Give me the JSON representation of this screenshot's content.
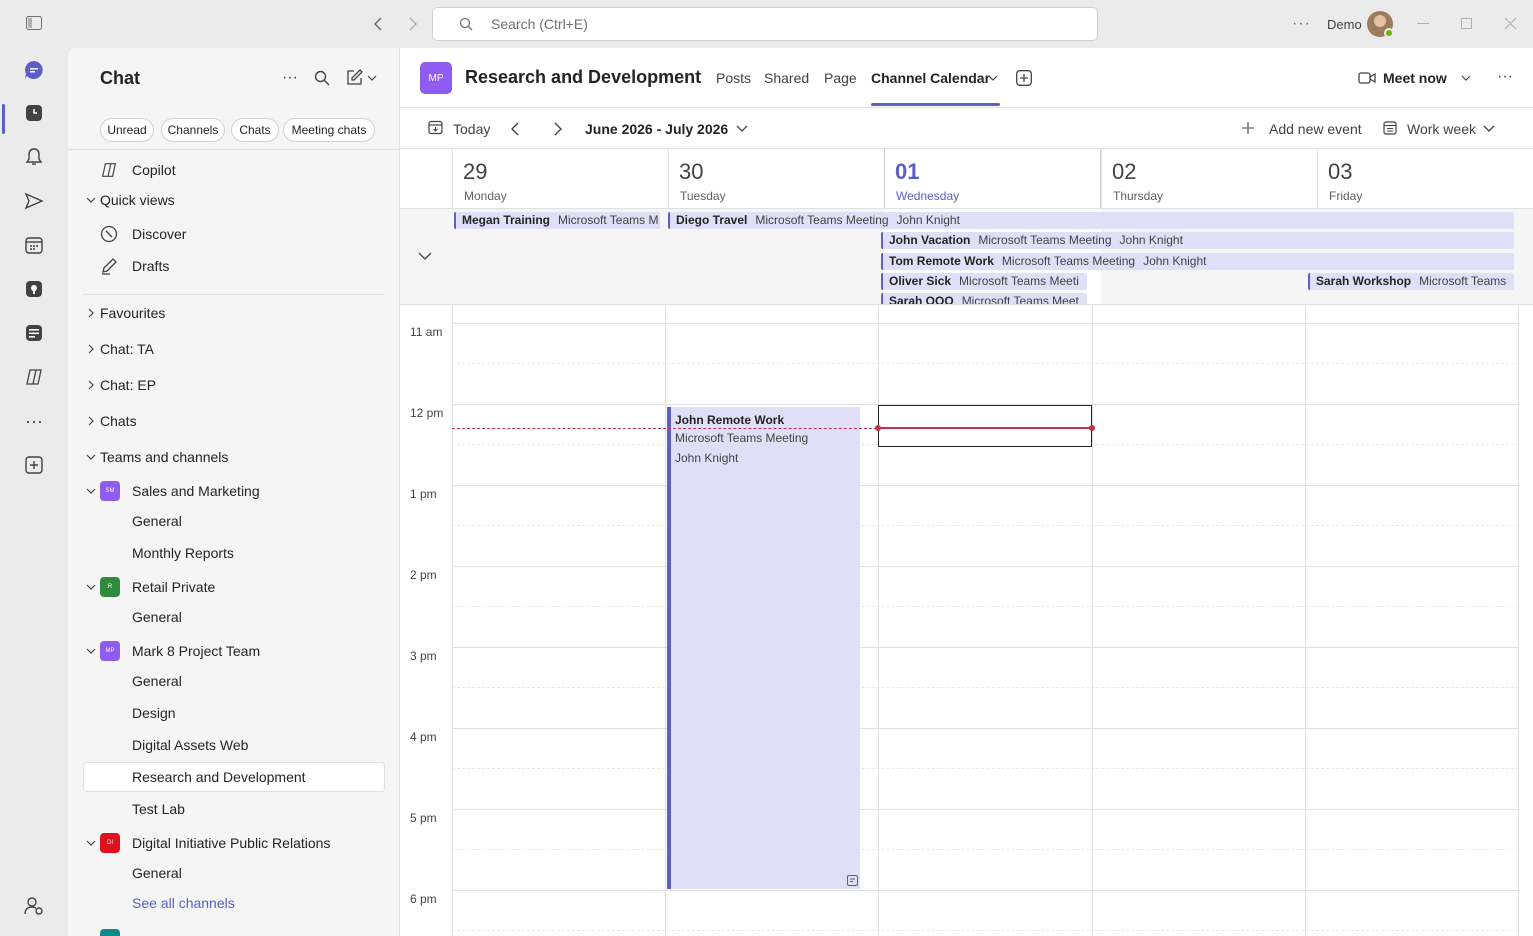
{
  "search": {
    "placeholder": "Search (Ctrl+E)"
  },
  "user": {
    "name": "Demo"
  },
  "sidebar": {
    "title": "Chat",
    "filters": [
      "Unread",
      "Channels",
      "Chats",
      "Meeting chats"
    ],
    "copilot": "Copilot",
    "quick_views": "Quick views",
    "discover": "Discover",
    "drafts": "Drafts",
    "favourites": "Favourites",
    "chat_ta": "Chat: TA",
    "chat_ep": "Chat: EP",
    "chats": "Chats",
    "teams_channels": "Teams and channels",
    "teams": [
      {
        "name": "Sales and Marketing",
        "initials": "SM",
        "color": "#8f5bf0",
        "channels": [
          "General",
          "Monthly Reports"
        ]
      },
      {
        "name": "Retail Private",
        "initials": "R",
        "color": "#2e8b3e",
        "channels": [
          "General"
        ]
      },
      {
        "name": "Mark 8 Project Team",
        "initials": "MP",
        "color": "#8f5bf0",
        "channels": [
          "General",
          "Design",
          "Digital Assets Web",
          "Research and Development",
          "Test Lab"
        ]
      },
      {
        "name": "Digital Initiative Public Relations",
        "initials": "DI",
        "color": "#e0101e",
        "channels": [
          "General"
        ]
      }
    ],
    "see_all": "See all channels"
  },
  "header": {
    "initials": "MP",
    "title": "Research and Development",
    "tabs": [
      "Posts",
      "Shared",
      "Page",
      "Channel Calendar"
    ],
    "meet_now": "Meet now"
  },
  "toolbar": {
    "today": "Today",
    "range": "June 2026 - July 2026",
    "add_event": "Add new event",
    "view": "Work week"
  },
  "days": [
    {
      "num": "29",
      "name": "Monday"
    },
    {
      "num": "30",
      "name": "Tuesday"
    },
    {
      "num": "01",
      "name": "Wednesday"
    },
    {
      "num": "02",
      "name": "Thursday"
    },
    {
      "num": "03",
      "name": "Friday"
    }
  ],
  "allday_events": [
    {
      "title": "Megan Training",
      "location": "Microsoft Teams M",
      "organizer": ""
    },
    {
      "title": "Diego Travel",
      "location": "Microsoft Teams Meeting",
      "organizer": "John Knight"
    },
    {
      "title": "John Vacation",
      "location": "Microsoft Teams Meeting",
      "organizer": "John Knight"
    },
    {
      "title": "Tom Remote Work",
      "location": "Microsoft Teams Meeting",
      "organizer": "John Knight"
    },
    {
      "title": "Oliver Sick",
      "location": "Microsoft Teams Meeti",
      "organizer": ""
    },
    {
      "title": "Sarah OOO",
      "location": "Microsoft Teams Meet",
      "organizer": ""
    },
    {
      "title": "Sarah Workshop",
      "location": "Microsoft Teams",
      "organizer": ""
    }
  ],
  "hours": [
    "11 am",
    "12 pm",
    "1 pm",
    "2 pm",
    "3 pm",
    "4 pm",
    "5 pm",
    "6 pm"
  ],
  "timed_event": {
    "title": "John Remote Work",
    "location": "Microsoft Teams Meeting",
    "organizer": "John Knight"
  },
  "colors": {
    "accent": "#5b5fc7",
    "event_bg": "#dfe0f8",
    "now_line": "#c4314b"
  }
}
